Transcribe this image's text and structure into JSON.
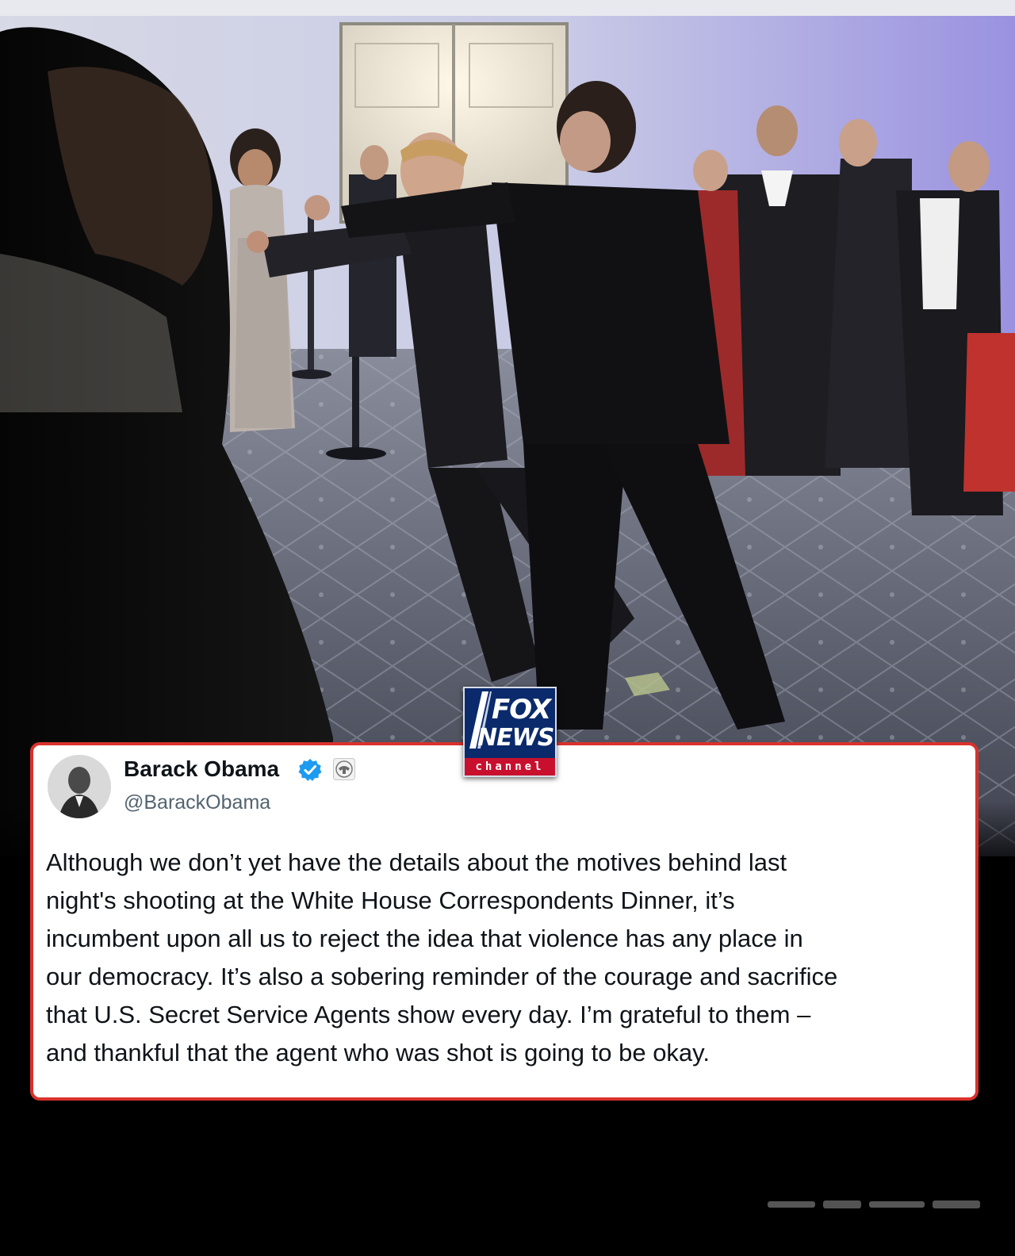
{
  "logo": {
    "line1": "FOX",
    "line2": "NEWS",
    "line3": "channel"
  },
  "tweet": {
    "author_name": "Barack Obama",
    "handle": "@BarackObama",
    "lines": [
      "Although we don’t yet have the details about the motives behind last",
      "night's shooting at the White House Correspondents Dinner, it’s",
      "incumbent upon all us to reject the idea that violence has any place in",
      "our democracy. It’s also a sobering reminder of the courage and sacrifice",
      "that U.S. Secret Service Agents show every day. I’m grateful to them –",
      "and thankful that the agent who was shot is going to be okay."
    ],
    "icons": {
      "verified": "verified-badge-icon",
      "government": "government-seal-icon"
    }
  },
  "colors": {
    "card_border": "#d8322c",
    "fox_blue": "#0b2a6b",
    "fox_red": "#c8102e",
    "verified_blue": "#1d9bf0",
    "text": "#0f1419",
    "handle": "#536471"
  }
}
